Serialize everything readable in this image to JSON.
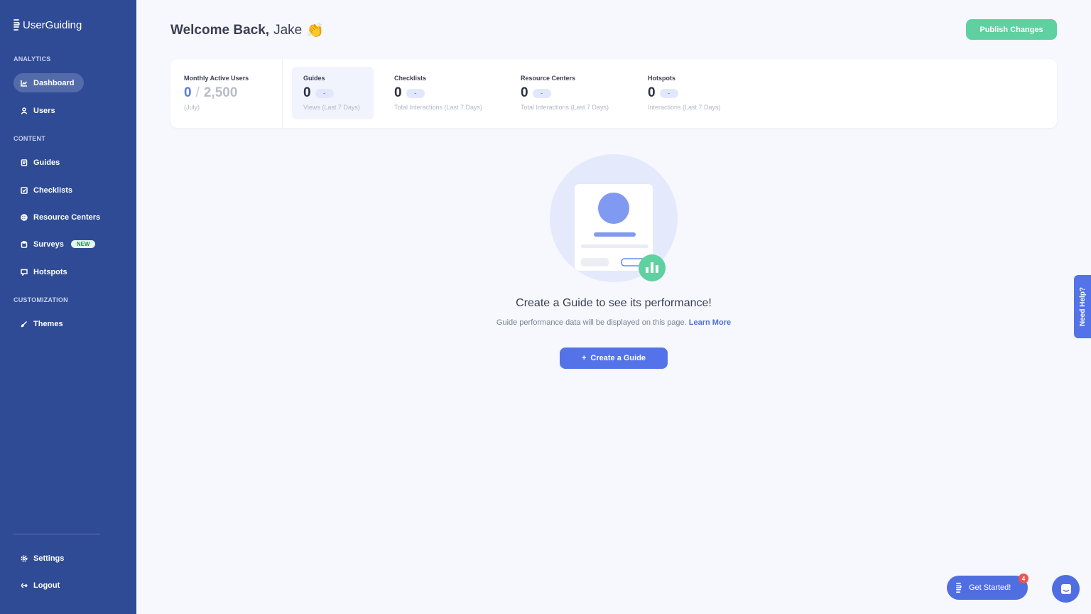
{
  "brand": {
    "name": "UserGuiding"
  },
  "sidebar": {
    "sections": {
      "analytics": "ANALYTICS",
      "content": "CONTENT",
      "customization": "CUSTOMIZATION"
    },
    "items": {
      "dashboard": "Dashboard",
      "users": "Users",
      "guides": "Guides",
      "checklists": "Checklists",
      "resource_centers": "Resource Centers",
      "surveys": "Surveys",
      "surveys_badge": "NEW",
      "hotspots": "Hotspots",
      "themes": "Themes",
      "settings": "Settings",
      "logout": "Logout"
    },
    "active_item": "Dashboard"
  },
  "header": {
    "welcome_prefix": "Welcome Back,",
    "user_name": "Jake",
    "wave_emoji": "👏",
    "publish_label": "Publish Changes"
  },
  "stats": {
    "mau": {
      "label": "Monthly Active Users",
      "value": "0",
      "separator": "/",
      "limit": "2,500",
      "sub": "(July)"
    },
    "guides": {
      "label": "Guides",
      "value": "0",
      "trend": "-",
      "sub": "Views (Last 7 Days)"
    },
    "checklists": {
      "label": "Checklists",
      "value": "0",
      "trend": "-",
      "sub": "Total Interactions (Last 7 Days)"
    },
    "resource_centers": {
      "label": "Resource Centers",
      "value": "0",
      "trend": "-",
      "sub": "Total Interactions (Last 7 Days)"
    },
    "hotspots": {
      "label": "Hotspots",
      "value": "0",
      "trend": "-",
      "sub": "Interactions (Last 7 Days)"
    }
  },
  "empty_state": {
    "title": "Create a Guide to see its performance!",
    "subtitle": "Guide performance data will be displayed on this page.",
    "learn_more": "Learn More",
    "button_icon": "+",
    "button_label": "Create a Guide"
  },
  "help_tab": {
    "label": "Need Help?"
  },
  "widgets": {
    "get_started_label": "Get Started!",
    "get_started_badge": "4"
  },
  "colors": {
    "sidebar": "#2f4b96",
    "accent": "#5473e8",
    "success": "#5fd0a0",
    "background": "#f6f8fd"
  }
}
